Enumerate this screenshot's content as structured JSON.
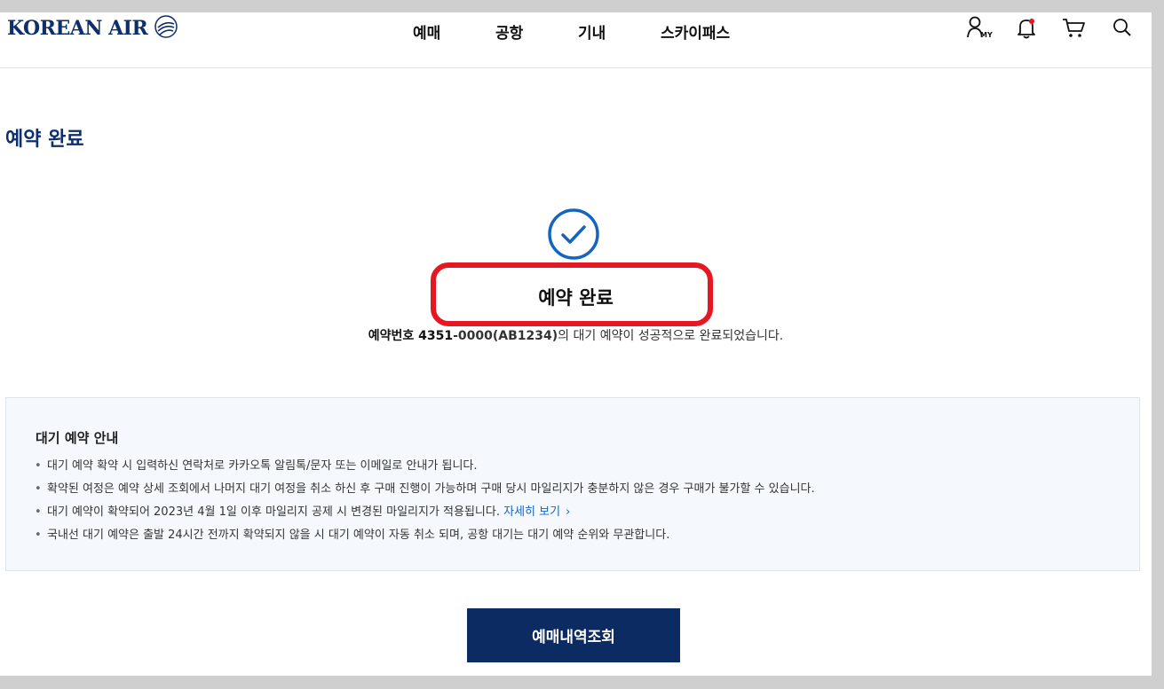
{
  "header": {
    "logo_text": "KOREAN AIR",
    "nav": [
      {
        "label": "예매"
      },
      {
        "label": "공항"
      },
      {
        "label": "기내"
      },
      {
        "label": "스카이패스"
      }
    ],
    "icons": {
      "my": {
        "name": "my-account-icon",
        "label": "MY"
      },
      "notification": {
        "name": "bell-icon",
        "badge_color": "#e51722"
      },
      "cart": {
        "name": "cart-icon"
      },
      "search": {
        "name": "search-icon"
      }
    }
  },
  "page": {
    "title": "예약 완료"
  },
  "result": {
    "status_icon": "check-circle-icon",
    "title": "예약 완료",
    "booking_label": "예약번호 4351",
    "booking_obscured": "-0000(AB1234)",
    "message_suffix": "의 대기 예약이 성공적으로 완료되었습니다."
  },
  "notice": {
    "title": "대기 예약 안내",
    "items": [
      "대기 예약 확약 시 입력하신 연락처로 카카오톡 알림톡/문자 또는 이메일로 안내가 됩니다.",
      "확약된 여정은 예약 상세 조회에서 나머지 대기 여정을 취소 하신 후 구매 진행이 가능하며 구매 당시 마일리지가 충분하지 않은 경우 구매가 불가할 수 있습니다.",
      "대기 예약이 확약되어 2023년 4월 1일 이후 마일리지 공제 시 변경된 마일리지가 적용됩니다.",
      "국내선 대기 예약은 출발 24시간 전까지 확약되지 않을 시 대기 예약이 자동 취소 되며, 공항 대기는 대기 예약 순위와 무관합니다."
    ],
    "more_link": "자세히 보기"
  },
  "actions": {
    "primary_label": "예매내역조회"
  },
  "colors": {
    "brand_navy": "#0c2b62",
    "accent_blue": "#1465c0",
    "highlight_red": "#e51722",
    "notice_bg": "#f5f9fd"
  }
}
